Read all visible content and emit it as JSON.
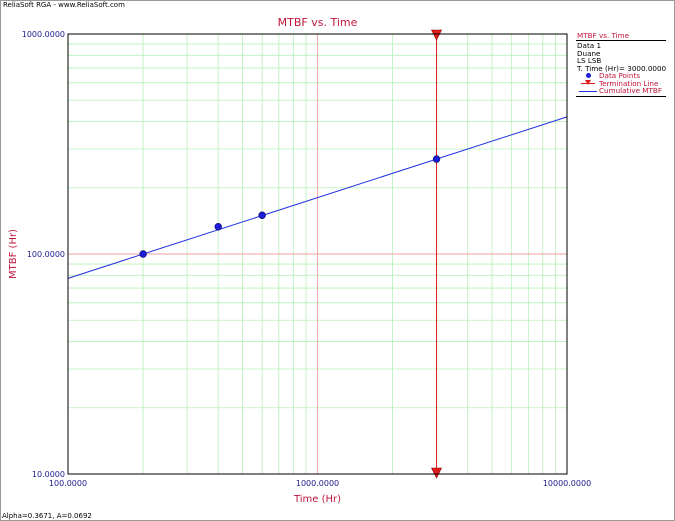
{
  "app": {
    "brand": "ReliaSoft RGA - www.ReliaSoft.com",
    "footer": "Alpha=0.3671, A=0.0692"
  },
  "legend": {
    "title": "MTBF vs. Time",
    "lines": [
      "Data 1",
      "Duane",
      "LS LSB",
      "T. Time (Hr)= 3000.0000"
    ],
    "items": [
      {
        "label": "Data Points",
        "icon": "blue-dot"
      },
      {
        "label": "Termination Line",
        "icon": "red-triangle-line"
      },
      {
        "label": "Cumulative MTBF",
        "icon": "blue-line"
      }
    ]
  },
  "colors": {
    "title": "#c0153a",
    "axis_text": "#1a1a8c",
    "major_grid": "#f2a0a0",
    "minor_grid": "#b8f0b8",
    "points": "#1c1cd9",
    "fit_line": "#2030e0",
    "termination": "#e21b1b"
  },
  "chart_data": {
    "type": "scatter",
    "title": "MTBF vs. Time",
    "xlabel": "Time (Hr)",
    "ylabel": "MTBF (Hr)",
    "xscale": "log",
    "yscale": "log",
    "xlim": [
      100,
      10000
    ],
    "ylim": [
      10,
      1000
    ],
    "x_ticks": [
      100,
      1000,
      10000
    ],
    "x_tick_labels": [
      "100.0000",
      "1000.0000",
      "10000.0000"
    ],
    "y_ticks": [
      10,
      100,
      1000
    ],
    "y_tick_labels": [
      "10.0000",
      "100.0000",
      "1000.0000"
    ],
    "grid": true,
    "legend_position": "right",
    "series": [
      {
        "name": "Data Points",
        "type": "scatter",
        "x": [
          200,
          400,
          600,
          3000
        ],
        "y": [
          100,
          133,
          150,
          270
        ]
      },
      {
        "name": "Cumulative MTBF",
        "type": "line",
        "x": [
          100,
          10000
        ],
        "y": [
          77.5,
          420
        ]
      }
    ],
    "termination_line": {
      "name": "Termination Line",
      "x": 3000
    }
  }
}
